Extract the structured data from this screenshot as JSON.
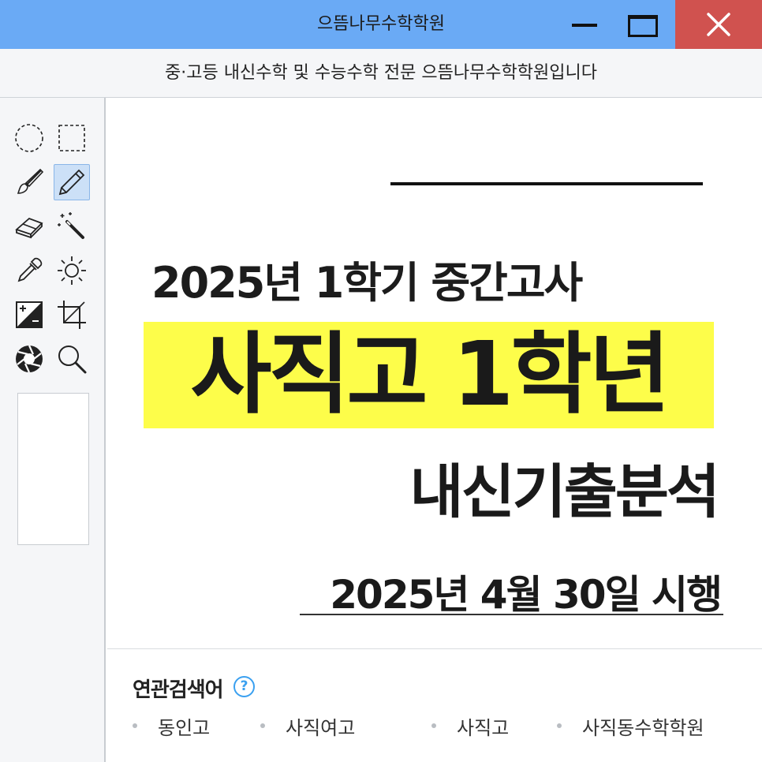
{
  "window": {
    "title": "으뜸나무수학학원",
    "subtitle": "중·고등 내신수학 및 수능수학 전문 으뜸나무수학학원입니다"
  },
  "toolbar": {
    "tools": [
      {
        "name": "ellipse-select",
        "icon": "ellipse-select-icon",
        "active": false
      },
      {
        "name": "rect-select",
        "icon": "rect-select-icon",
        "active": false
      },
      {
        "name": "brush",
        "icon": "brush-icon",
        "active": false
      },
      {
        "name": "pencil",
        "icon": "pencil-icon",
        "active": true
      },
      {
        "name": "eraser",
        "icon": "eraser-icon",
        "active": false
      },
      {
        "name": "magic-wand",
        "icon": "magic-wand-icon",
        "active": false
      },
      {
        "name": "eyedropper",
        "icon": "eyedropper-icon",
        "active": false
      },
      {
        "name": "brightness",
        "icon": "brightness-icon",
        "active": false
      },
      {
        "name": "exposure",
        "icon": "exposure-icon",
        "active": false
      },
      {
        "name": "crop",
        "icon": "crop-icon",
        "active": false
      },
      {
        "name": "aperture",
        "icon": "aperture-icon",
        "active": false
      },
      {
        "name": "zoom",
        "icon": "zoom-icon",
        "active": false
      }
    ]
  },
  "poster": {
    "line1": "2025년 1학기 중간고사",
    "line2": "사직고 1학년",
    "line3": "내신기출분석",
    "line4": "2025년 4월 30일 시행",
    "highlight_color": "#fdfd4a"
  },
  "related": {
    "title": "연관검색어",
    "help": "?",
    "items": [
      "동인고",
      "사직여고",
      "사직고",
      "사직동수학학원"
    ]
  },
  "colors": {
    "titlebar": "#6aaaf5",
    "close": "#d0524f",
    "accent": "#3aa0f0"
  }
}
